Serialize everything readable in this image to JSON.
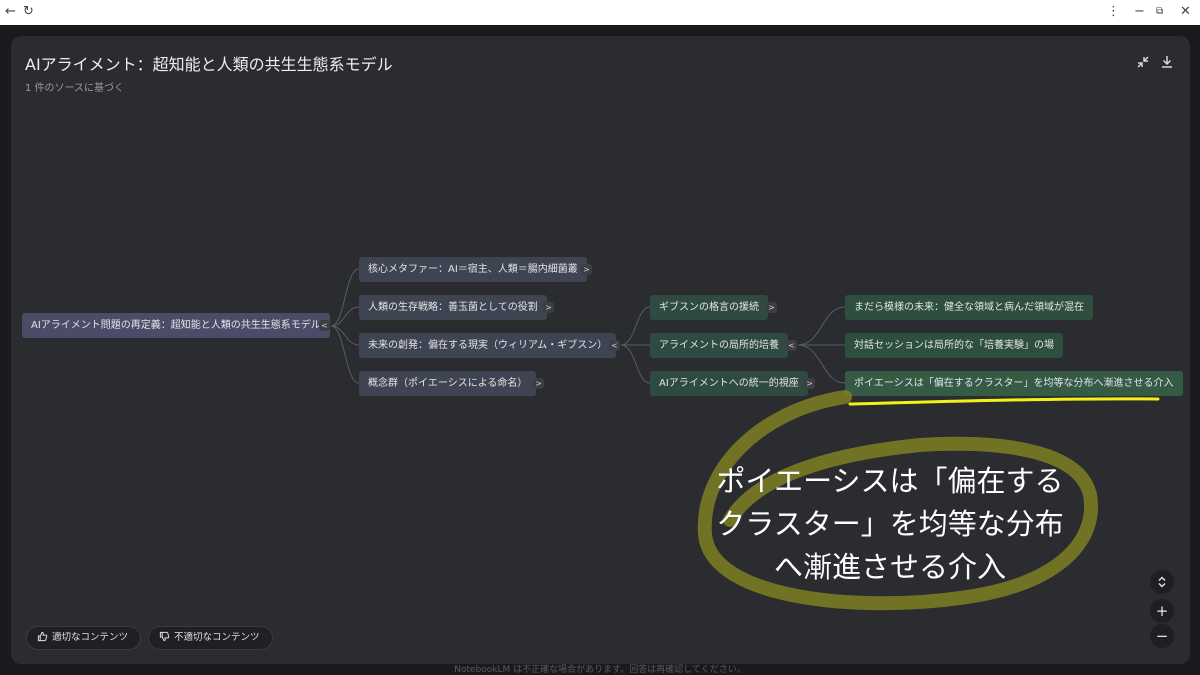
{
  "colors": {
    "panel": "#2b2c30",
    "root_node": "#4a4c68",
    "level1_node": "#3f4452",
    "level2_node": "#2f4a40",
    "level3_node": "#2e4f3e",
    "highlight_underline": "#f2f21a",
    "scribble": "#8a8a2a"
  },
  "header": {
    "title": "AIアライメント：超知能と人類の共生生態系モデル",
    "subtitle": "1 件のソースに基づく",
    "icons": [
      "collapse-icon",
      "download-icon"
    ]
  },
  "mindmap": {
    "root": {
      "label": "AIアライメント問題の再定義：超知能と人類の共生生態系モデル",
      "toggle": "<"
    },
    "level1": [
      {
        "label": "核心メタファー：AI＝宿主、人類＝腸内細菌叢",
        "toggle": ">"
      },
      {
        "label": "人類の生存戦略：善玉菌としての役割",
        "toggle": ">"
      },
      {
        "label": "未来の創発：偏在する現実（ウィリアム・ギブスン）",
        "toggle": "<"
      },
      {
        "label": "概念群（ポイエーシスによる命名）",
        "toggle": ">"
      }
    ],
    "level2": [
      {
        "label": "ギブスンの格言の援続",
        "toggle": ">"
      },
      {
        "label": "アライメントの局所的培養",
        "toggle": "<"
      },
      {
        "label": "AIアライメントへの統一的視座",
        "toggle": ">"
      }
    ],
    "level3": [
      {
        "label": "まだら模様の未来：健全な領域と病んだ領域が混在"
      },
      {
        "label": "対話セッションは局所的な「培養実験」の場"
      },
      {
        "label": "ポイエーシスは「偏在するクラスター」を均等な分布へ漸進させる介入"
      }
    ]
  },
  "annotation": {
    "line1": "ポイエーシスは「偏在する",
    "line2": "クラスター」を均等な分布",
    "line3": "へ漸進させる介入"
  },
  "footer": {
    "good_label": "適切なコンテンツ",
    "bad_label": "不適切なコンテンツ",
    "disclaimer": "NotebookLM は不正確な場合があります。回答は再確認してください。"
  },
  "zoom": {
    "fit_icon": "unfold-icon",
    "in": "+",
    "out": "−"
  }
}
